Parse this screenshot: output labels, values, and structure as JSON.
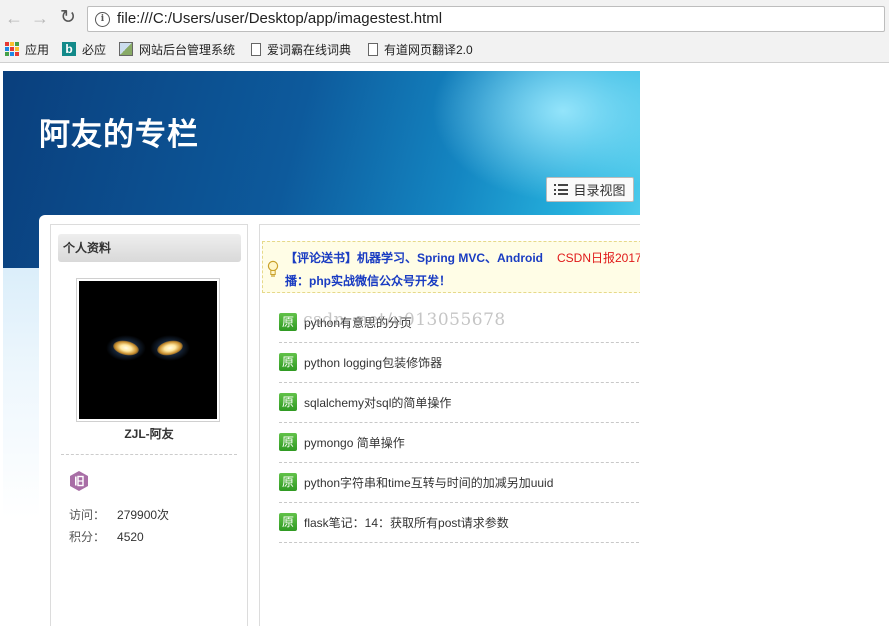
{
  "browser": {
    "url": "file:///C:/Users/user/Desktop/app/imagestest.html",
    "bookmarks": [
      {
        "label": "应用",
        "icon": "apps-grid-icon"
      },
      {
        "label": "必应",
        "icon": "bing-icon"
      },
      {
        "label": "网站后台管理系统",
        "icon": "image-page-icon"
      },
      {
        "label": "爱词霸在线词典",
        "icon": "document-icon"
      },
      {
        "label": "有道网页翻译2.0",
        "icon": "document-icon"
      }
    ]
  },
  "header": {
    "title": "阿友的专栏",
    "catalog_button": "目录视图"
  },
  "sidebar": {
    "heading": "个人资料",
    "user_name": "ZJL-阿友",
    "stats": [
      {
        "label": "访问：",
        "value": "279900次"
      },
      {
        "label": "积分：",
        "value": "4520"
      }
    ]
  },
  "notice": {
    "line1": "【评论送书】机器学习、Spring MVC、Android",
    "line1_red": "CSDN日报2017",
    "line2": "播：php实战微信公众号开发！"
  },
  "articles": {
    "tag": "原",
    "items": [
      "python有意思的分页",
      "python logging包装修饰器",
      "sqlalchemy对sql的简单操作",
      "pymongo 简单操作",
      "python字符串和time互转与时间的加减另加uuid",
      "flask笔记：14：获取所有post请求参数"
    ]
  },
  "watermark": "csdn. net/u013055678",
  "colors": {
    "banner_dark": "#0a3f7d",
    "banner_light": "#55d0ee",
    "link_blue": "#1a3cc2",
    "notice_red": "#e01919",
    "tag_green": "#2f9a22"
  }
}
